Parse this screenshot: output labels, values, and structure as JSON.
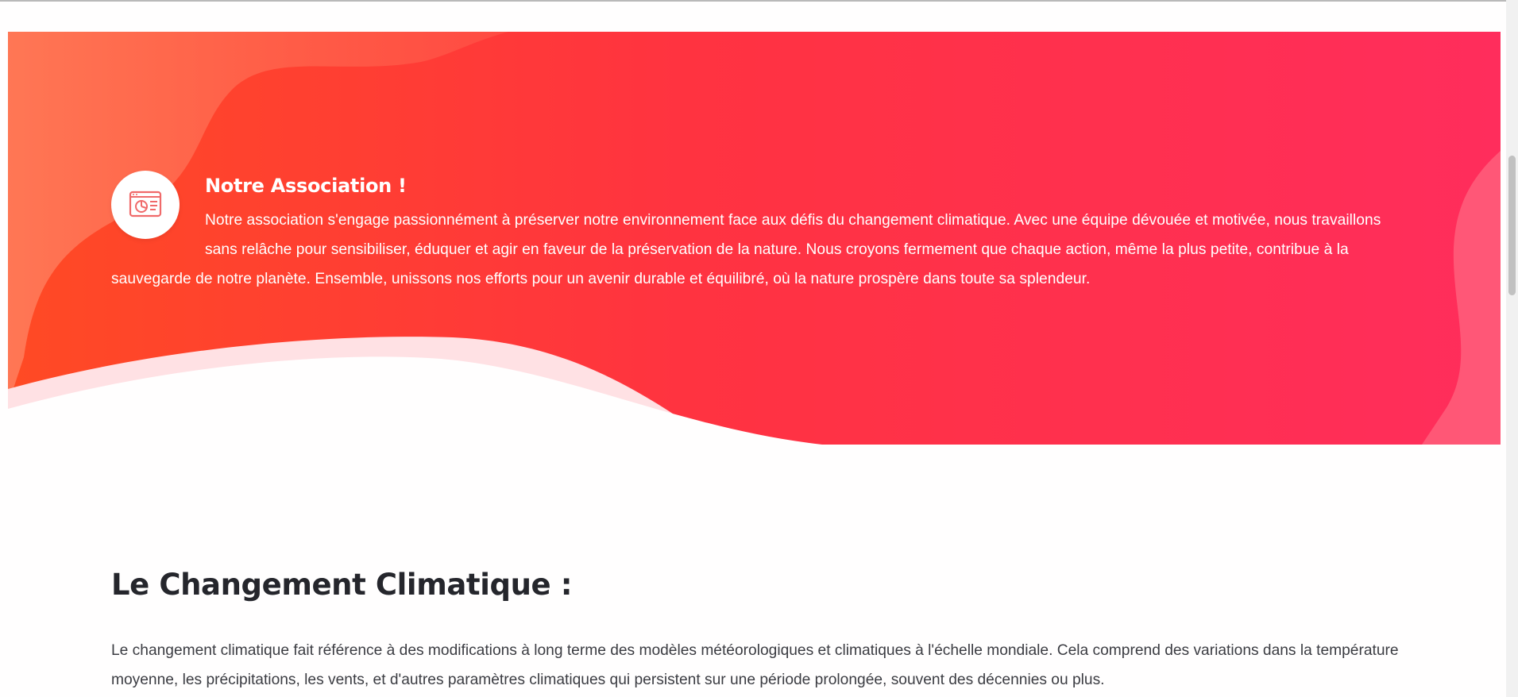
{
  "colors": {
    "hero_start": "#ff4a24",
    "hero_end": "#ff2d5c",
    "heading_dark": "#25262c",
    "body_text": "#3b3c42",
    "logo_accent": "#f06a6a"
  },
  "hero": {
    "logo_icon": "presentation-chart-icon",
    "title": "Notre Association !",
    "text": "Notre association s'engage passionnément à préserver notre environnement face aux défis du changement climatique. Avec une équipe dévouée et motivée, nous travaillons sans relâche pour sensibiliser, éduquer et agir en faveur de la préservation de la nature. Nous croyons fermement que chaque action, même la plus petite, contribue à la sauvegarde de notre planète. Ensemble, unissons nos efforts pour un avenir durable et équilibré, où la nature prospère dans toute sa splendeur."
  },
  "section": {
    "title": "Le Changement Climatique :",
    "text": "Le changement climatique fait référence à des modifications à long terme des modèles météorologiques et climatiques à l'échelle mondiale. Cela comprend des variations dans la température moyenne, les précipitations, les vents, et d'autres paramètres climatiques qui persistent sur une période prolongée, souvent des décennies ou plus."
  }
}
